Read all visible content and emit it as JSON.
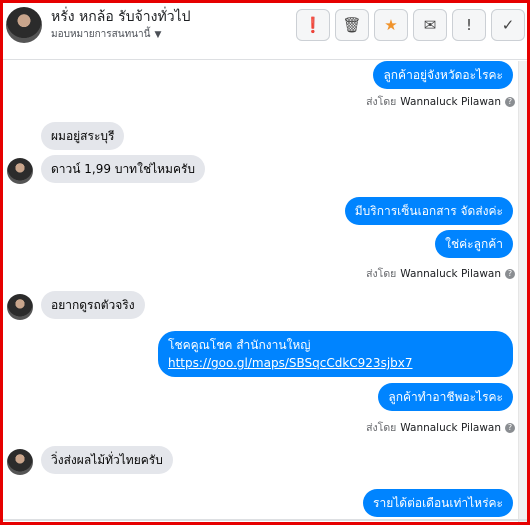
{
  "header": {
    "title": "หรั่ง หกล้อ รับจ้างทั่วไป",
    "subtitle": "มอบหมายการสนทนานี้",
    "actions": [
      {
        "icon": "exclamation-circle-icon",
        "glyph": "❗"
      },
      {
        "icon": "trash-icon",
        "glyph": "🗑"
      },
      {
        "icon": "star-icon",
        "glyph": "★"
      },
      {
        "icon": "mail-icon",
        "glyph": "✉"
      },
      {
        "icon": "exclamation-icon",
        "glyph": "!"
      },
      {
        "icon": "check-icon",
        "glyph": "✓"
      }
    ]
  },
  "messages": {
    "m1": "ลูกค้าอยู่จังหวัดอะไรคะ",
    "m2": "ผมอยู่สระบุรี",
    "m3": "ดาวน์ 1,99 บาทใช่ไหมครับ",
    "m4": "มีบริการเซ็นเอกสาร จัดส่งค่ะ",
    "m5": "ใช่ค่ะลูกค้า",
    "m6": "อยากดูรถตัวจริง",
    "m7_line1": "โชคคูณโชค สำนักงานใหญ่",
    "m7_link": "https://goo.gl/maps/SBSqcCdkC923sjbx7",
    "m8": "ลูกค้าทำอาชีพอะไรคะ",
    "m9": "วิ่งส่งผลไม้ทั่วไทยครับ",
    "m10": "รายได้ต่อเดือนเท่าไหร่คะ"
  },
  "sent_by": {
    "prefix": "ส่งโดย",
    "name": "Wannaluck Pilawan",
    "help": "?"
  },
  "colors": {
    "outgoing": "#0084ff",
    "incoming": "#e4e6eb",
    "frame": "#e60000"
  }
}
